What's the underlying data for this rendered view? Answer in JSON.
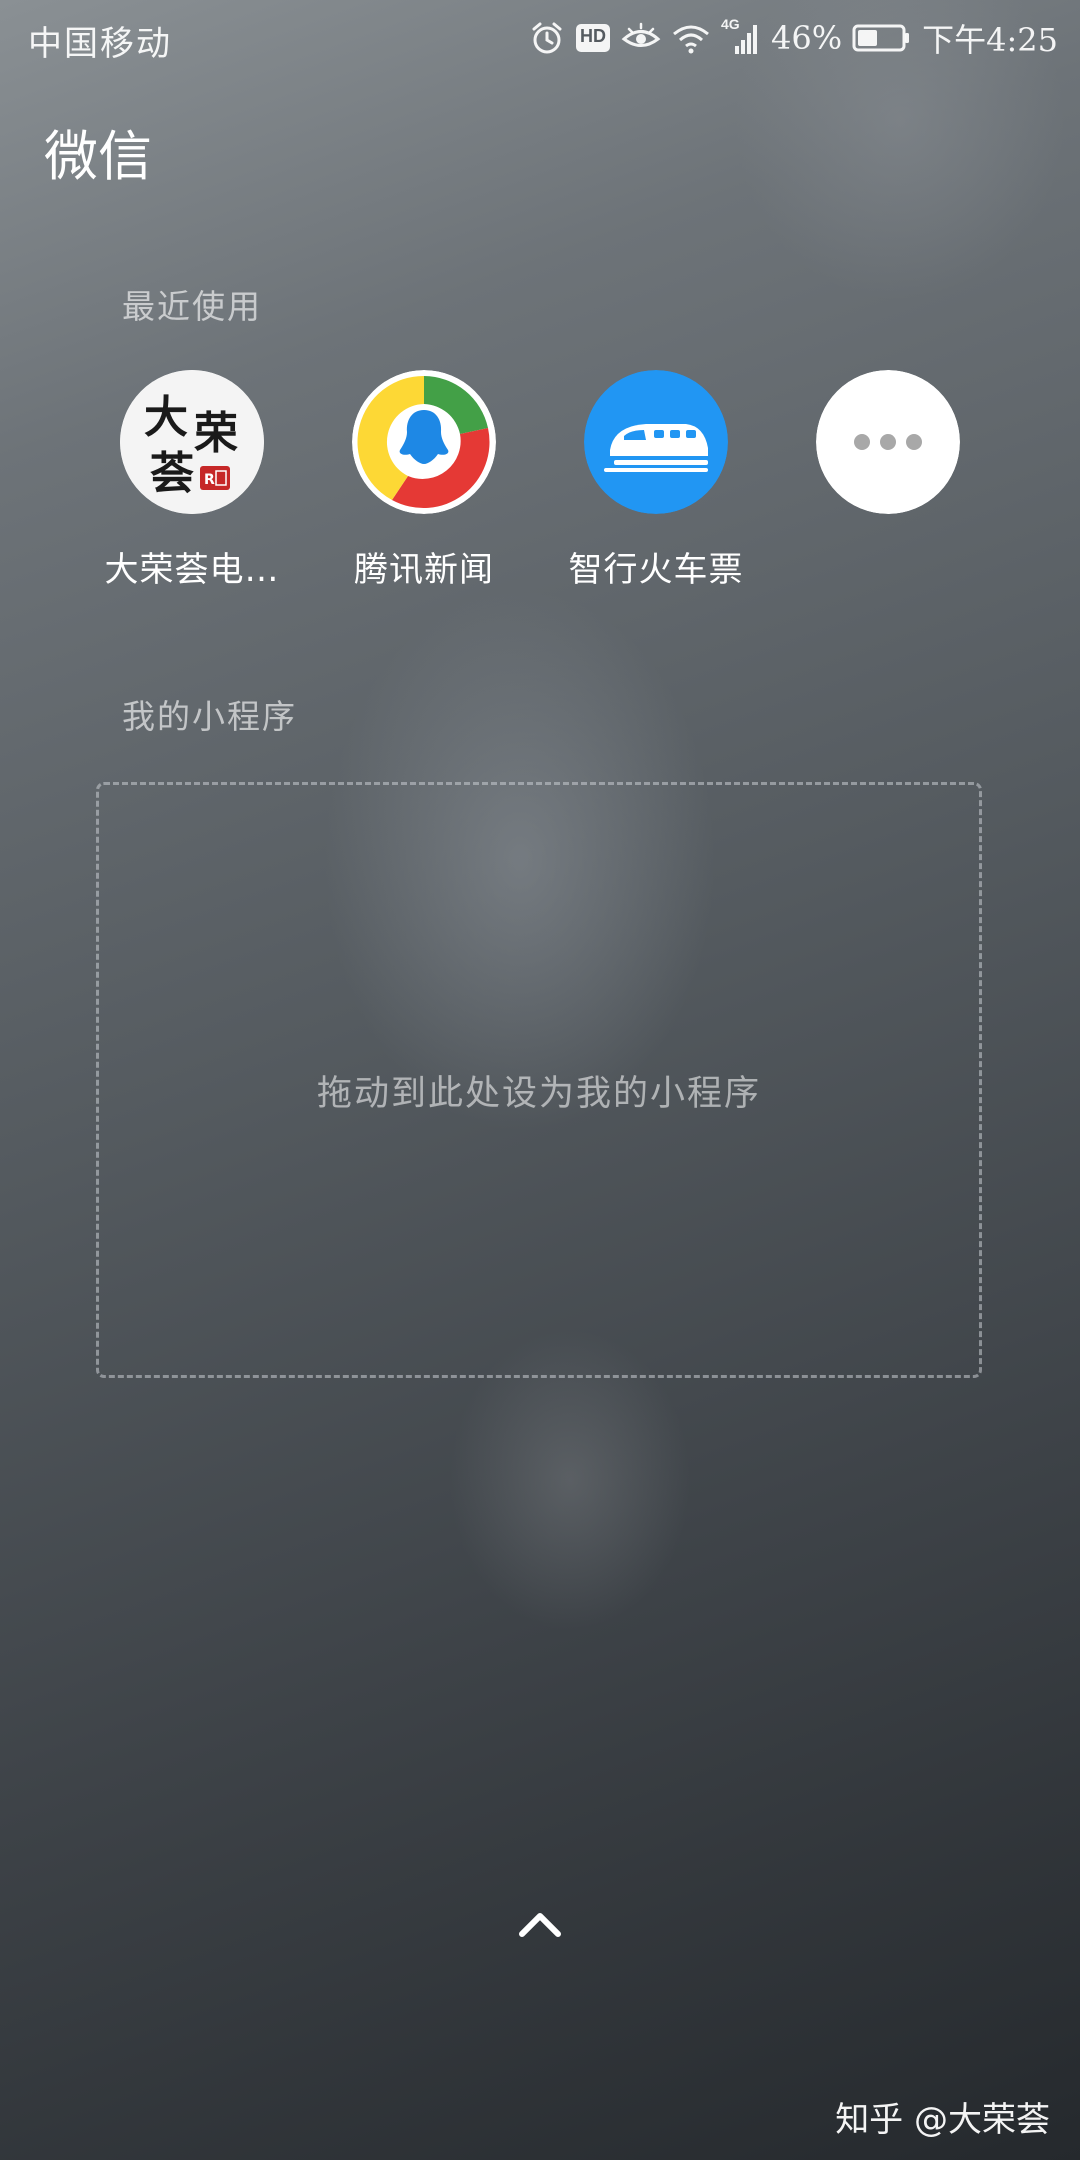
{
  "status_bar": {
    "carrier": "中国移动",
    "network": "4G",
    "hd_badge": "HD",
    "battery_percent": "46%",
    "battery_level": 0.46,
    "time": "下午4:25",
    "icons": [
      "alarm-icon",
      "hd-icon",
      "eye-comfort-icon",
      "wifi-icon",
      "signal-icon",
      "battery-icon"
    ]
  },
  "header": {
    "title": "微信"
  },
  "recent": {
    "label": "最近使用",
    "apps": [
      {
        "label": "大荣荟电…",
        "icon": "darongui-logo-icon",
        "logo_chars": "大荣荟"
      },
      {
        "label": "腾讯新闻",
        "icon": "tencent-news-icon"
      },
      {
        "label": "智行火车票",
        "icon": "train-icon"
      },
      {
        "label": "",
        "icon": "more-icon"
      }
    ]
  },
  "my_mini_programs": {
    "label": "我的小程序",
    "drop_hint": "拖动到此处设为我的小程序"
  },
  "footer": {
    "watermark": "知乎 @大荣荟"
  },
  "colors": {
    "train_blue": "#2196f3",
    "tencent_red": "#e53935",
    "tencent_green": "#43a047",
    "tencent_yellow": "#fdd835",
    "tencent_blue": "#1e88e5"
  }
}
